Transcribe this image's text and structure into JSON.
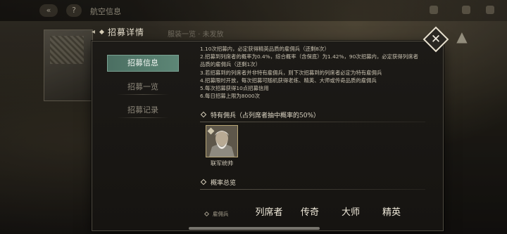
{
  "top_bar": {
    "back_icon": "«",
    "help_icon": "?",
    "title": "航空信息"
  },
  "background": {
    "subtitle": "服装一览 · 未发放",
    "right_icon": "▲"
  },
  "modal": {
    "title": "招募详情",
    "close_icon": "✕"
  },
  "nav": {
    "items": [
      {
        "label": "招募信息",
        "active": true
      },
      {
        "label": "招募一览",
        "active": false
      },
      {
        "label": "招募记录",
        "active": false
      }
    ]
  },
  "rules": [
    "1.10次招募内，必定获得精英品质的雇佣兵（还剩8次）",
    "2.招募到列席者的概率为0.4%，综合概率（含保底）为1.42%，90次招募内，必定获得列席者",
    "品质的雇佣兵（还剩1次）",
    "3.若招募到的列席者并非特有雇佣兵，则下次招募到的列席者必定为特有雇佣兵",
    "4.招募限时开放，每次招募可随机获得老练、精英、大师或传奇品质的雇佣兵",
    "5.每次招募获得10点招募信用",
    "6.每日招募上限为8000次"
  ],
  "featured": {
    "heading": "特有佣兵（占列席者抽中概率的50%）",
    "mercenary_name": "联军统帅"
  },
  "probability": {
    "heading": "概率总览",
    "row_label": "雇佣兵",
    "columns": [
      "列席者",
      "传奇",
      "大师",
      "精英"
    ]
  },
  "colors": {
    "accent": "#5d8676",
    "card_border": "#b8a676",
    "panel_bg": "#1c1a17"
  }
}
